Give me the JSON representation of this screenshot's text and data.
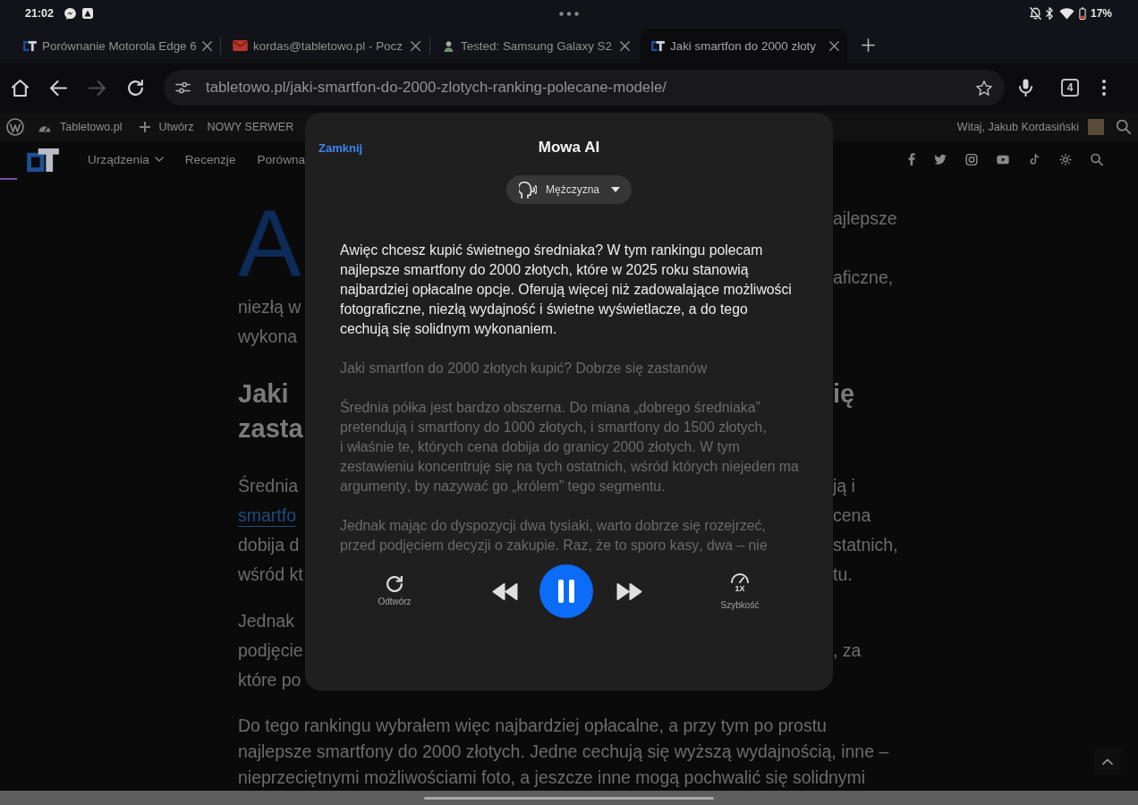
{
  "status_bar": {
    "time": "21:02",
    "battery": "17%"
  },
  "tabs": [
    {
      "kind": "site",
      "title": "Porównanie Motorola Edge 6",
      "selected": false
    },
    {
      "kind": "mail",
      "title": "kordas@tabletowo.pl - Pocz",
      "selected": false
    },
    {
      "kind": "profile",
      "title": "Tested: Samsung Galaxy S2",
      "selected": false
    },
    {
      "kind": "site",
      "title": "Jaki smartfon do 2000 złoty",
      "selected": true
    }
  ],
  "toolbar": {
    "back_disabled": false,
    "forward_disabled": true,
    "url": "tabletowo.pl/jaki-smartfon-do-2000-zlotych-ranking-polecane-modele/",
    "tab_count": "4"
  },
  "admin_bar": {
    "site_name": "Tabletowo.pl",
    "new_label": "Utwórz",
    "custom_link": "NOWY SERWER",
    "greeting": "Witaj, Jakub Kordasiński"
  },
  "site_header": {
    "nav": [
      {
        "label": "Urządzenia",
        "has_submenu": true
      },
      {
        "label": "Recenzje",
        "has_submenu": false
      },
      {
        "label": "Porówna",
        "has_submenu": false
      }
    ],
    "reading_progress": {
      "level": 0.015
    }
  },
  "article": {
    "blocks": [
      {
        "kind": "lead",
        "drop_cap": "A",
        "first_line": "ajlepsze",
        "lines": [
          {
            "right": "aficzne,"
          },
          {
            "left": "niezłą w"
          },
          {
            "left": "wykona"
          }
        ]
      },
      {
        "kind": "heading",
        "lines": [
          {
            "left": "Jaki",
            "right": "ię"
          },
          {
            "left": "zasta"
          }
        ]
      },
      {
        "kind": "paragraph",
        "lines": [
          {
            "left": "Średnia",
            "right": "ją i"
          },
          {
            "left": "smartfo",
            "left_link": true,
            "right": "cena"
          },
          {
            "left": "dobija d",
            "right": "statnich,"
          },
          {
            "left": "wśród kt",
            "right": "tu."
          }
        ]
      },
      {
        "kind": "paragraph",
        "lines": [
          {
            "left": "Jednak"
          },
          {
            "left": "podjęcie",
            "right": ", za"
          },
          {
            "left": "które po"
          }
        ]
      },
      {
        "kind": "full",
        "text": "Do tego rankingu wybrałem więc najbardziej opłacalne, a przy tym po prostu najlepsze smartfony do 2000 złotych. Jedne cechują się wyższą wydajnością, inne – nieprzeciętnymi możliwościami foto, a jeszcze inne mogą pochwalić się solidnymi"
      }
    ]
  },
  "modal": {
    "close_label": "Zamknij",
    "title": "Mowa AI",
    "voice": "Mężczyzna",
    "paragraphs": [
      {
        "text": "Awięc chcesz kupić świetnego średniaka? W tym rankingu polecam najlepsze smartfony do 2000 złotych, które w 2025 roku stanowią najbardziej opłacalne opcje. Oferują więcej niż zadowalające możliwości fotograficzne, niezłą wydajność i świetne wyświetlacze, a do tego cechują się solidnym wykonaniem.",
        "active": true
      },
      {
        "text": "Jaki smartfon do 2000 złotych kupić? Dobrze się zastanów",
        "active": false
      },
      {
        "text": "Średnia półka jest bardzo obszerna. Do miana „dobrego średniaka” pretendują i smartfony do 1000 złotych, i smartfony do 1500 złotych, i właśnie te, których cena dobija do granicy 2000 złotych. W tym zestawieniu koncentruję się na tych ostatnich, wśród których niejeden ma argumenty, by nazywać go „królem” tego segmentu.",
        "active": false
      },
      {
        "text": "Jednak mając do dyspozycji dwa tysiaki, warto dobrze się rozejrzeć, przed podjęciem decyzji o zakupie. Raz, że to sporo kasy, dwa – nie",
        "active": false
      }
    ],
    "player": {
      "replay_label": "Odtwórz",
      "playing": true,
      "speed_value": "1X",
      "speed_label": "Szybkość"
    }
  }
}
